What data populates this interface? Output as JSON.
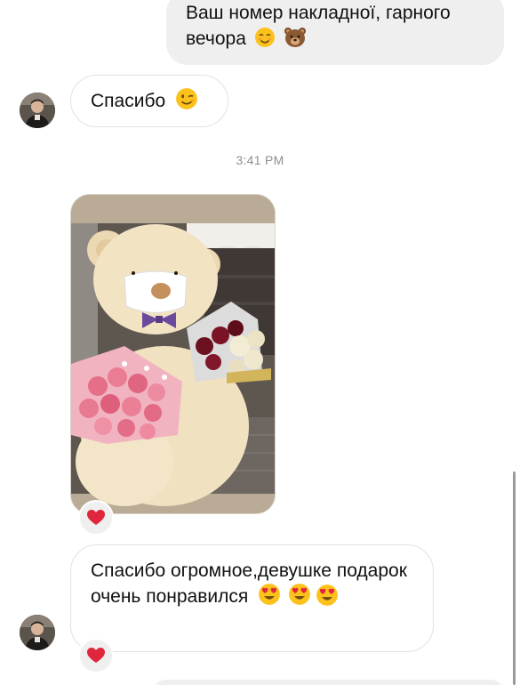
{
  "conversation": {
    "outgoing_message": {
      "text": "Ваш номер накладної, гарного\nвечора"
    },
    "incoming_message_1": {
      "text": "Спасибо"
    },
    "timestamp": "3:41 PM",
    "incoming_message_2": {
      "text": "Спасибо огромное,девушке подарок очень понравился"
    }
  },
  "icons": {
    "smiling_face": "smiling-face-emoji",
    "bear": "bear-face-emoji",
    "winking_face": "winking-face-emoji",
    "heart_eyes": "heart-eyes-emoji",
    "reaction": "red-heart-reaction"
  },
  "colors": {
    "outgoing_bubble": "#efefef",
    "incoming_border": "#e2e2e2",
    "timestamp": "#8e8e8e",
    "heart": "#e0263d"
  }
}
